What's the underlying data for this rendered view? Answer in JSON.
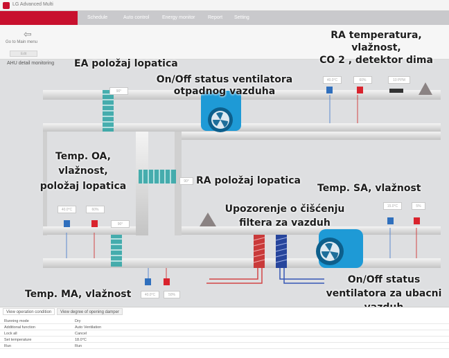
{
  "app": {
    "title": "LG Advanced Multi"
  },
  "nav": {
    "brand": "",
    "items": [
      "Schedule",
      "Auto control",
      "Energy monitor",
      "Report",
      "Setting"
    ]
  },
  "toolbar": {
    "back_label": "Go to Main menu",
    "extra_button": "Edit"
  },
  "page": {
    "tab": "AHU detail monitoring"
  },
  "annotations": {
    "ea_damper": "EA položaj lopatica",
    "exhaust_fan_1": "On/Off status ventilatora",
    "exhaust_fan_2": "otpadnog vazduha",
    "ra_1": "RA temperatura,",
    "ra_2": "vlažnost,",
    "ra_3": "CO 2 , detektor dima",
    "oa_1": "Temp. OA,",
    "oa_2": "vlažnost,",
    "oa_3": "položaj lopatica",
    "ra_damper": "RA položaj lopatica",
    "sa": "Temp. SA, vlažnost",
    "filter_1": "Upozorenje o čišćenju",
    "filter_2": "filtera za vazduh",
    "ma": "Temp. MA, vlažnost",
    "supply_fan_1": "On/Off status",
    "supply_fan_2": "ventilatora za ubacni",
    "supply_fan_3": "vazduh"
  },
  "readouts": {
    "ea_damper": "90°",
    "ra_temp": "40.0°C",
    "ra_hum": "60%",
    "ra_co2": "10 PPM",
    "oa_temp": "40.0°C",
    "oa_hum": "60%",
    "oa_damper": "90°",
    "ra_damper": "90°",
    "sa_temp": "15.0°C",
    "sa_hum": "5%",
    "ma_temp": "40.0°C",
    "ma_hum": "50%"
  },
  "bottom": {
    "tabs": [
      "View operation condition",
      "View degree of opening damper"
    ],
    "rows": [
      {
        "k": "Running mode",
        "v": "Dry"
      },
      {
        "k": "Additional function",
        "v": "Auto Ventilation"
      },
      {
        "k": "Lock all",
        "v": "Cancel"
      },
      {
        "k": "Set temperature",
        "v": "18.0°C"
      },
      {
        "k": "Run",
        "v": "Run"
      }
    ]
  },
  "colors": {
    "brand": "#c8102e",
    "fan": "#1e9ad6",
    "sensor_blue": "#2f6fbd",
    "sensor_red": "#d9232d",
    "damper_teal": "#2aa3a3"
  }
}
